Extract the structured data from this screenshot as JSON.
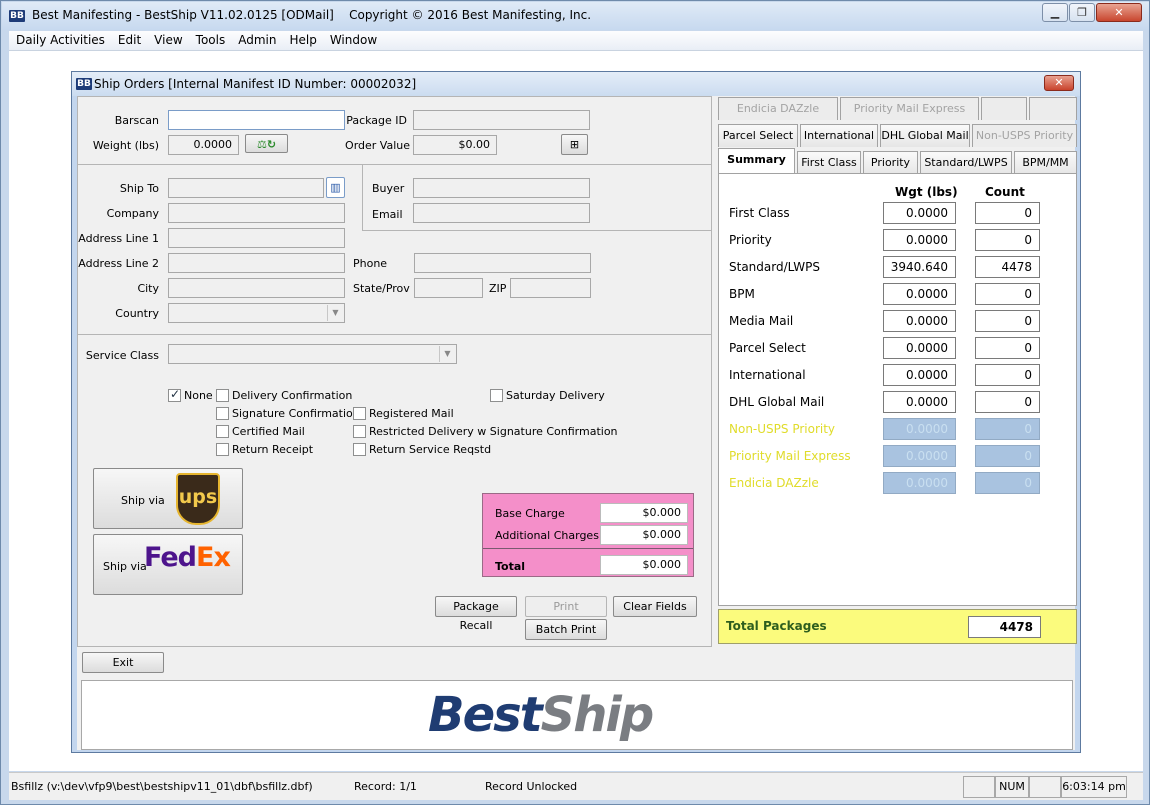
{
  "app": {
    "title": "Best Manifesting - BestShip V11.02.0125 [ODMail]",
    "copyright": "Copyright © 2016 Best Manifesting, Inc.",
    "logo": "BB"
  },
  "menu": [
    "Daily Activities",
    "Edit",
    "View",
    "Tools",
    "Admin",
    "Help",
    "Window"
  ],
  "child": {
    "title": "Ship Orders [Internal Manifest ID Number: 00002032]"
  },
  "form": {
    "barscan_label": "Barscan",
    "barscan_value": "",
    "weight_label": "Weight (lbs)",
    "weight_value": "0.0000",
    "package_id_label": "Package ID",
    "package_id_value": "",
    "order_value_label": "Order Value",
    "order_value_value": "$0.00",
    "ship_to_label": "Ship To",
    "company_label": "Company",
    "address1_label": "Address Line 1",
    "address2_label": "Address Line 2",
    "city_label": "City",
    "country_label": "Country",
    "buyer_label": "Buyer",
    "email_label": "Email",
    "phone_label": "Phone",
    "state_label": "State/Prov",
    "zip_label": "ZIP",
    "service_class_label": "Service Class"
  },
  "options": {
    "none": "None",
    "delivery_confirmation": "Delivery Confirmation",
    "signature_confirmation": "Signature Confirmation",
    "certified_mail": "Certified Mail",
    "return_receipt": "Return Receipt",
    "registered_mail": "Registered Mail",
    "restricted_delivery": "Restricted Delivery w Signature Confirmation",
    "return_service": "Return Service Reqstd",
    "saturday_delivery": "Saturday Delivery"
  },
  "ship": {
    "ship_via": "Ship via",
    "ups": "ups",
    "fedex_fed": "Fed",
    "fedex_ex": "Ex"
  },
  "charges": {
    "base_label": "Base Charge",
    "base_value": "$0.000",
    "additional_label": "Additional Charges",
    "additional_value": "$0.000",
    "total_label": "Total",
    "total_value": "$0.000"
  },
  "buttons": {
    "package_recall": "Package Recall",
    "print": "Print",
    "clear_fields": "Clear Fields",
    "batch_print": "Batch Print",
    "exit": "Exit"
  },
  "tabs": {
    "row1": [
      "Endicia DAZzle",
      "Priority Mail Express",
      "",
      ""
    ],
    "row2": [
      "Parcel Select",
      "International",
      "DHL Global Mail",
      "Non-USPS Priority"
    ],
    "row3": [
      "Summary",
      "First Class",
      "Priority",
      "Standard/LWPS",
      "BPM/MM"
    ]
  },
  "summary": {
    "header_weight": "Wgt (lbs)",
    "header_count": "Count",
    "rows": [
      {
        "label": "First Class",
        "weight": "0.0000",
        "count": "0"
      },
      {
        "label": "Priority",
        "weight": "0.0000",
        "count": "0"
      },
      {
        "label": "Standard/LWPS",
        "weight": "3940.640",
        "count": "4478"
      },
      {
        "label": "BPM",
        "weight": "0.0000",
        "count": "0"
      },
      {
        "label": "Media Mail",
        "weight": "0.0000",
        "count": "0"
      },
      {
        "label": "Parcel Select",
        "weight": "0.0000",
        "count": "0"
      },
      {
        "label": "International",
        "weight": "0.0000",
        "count": "0"
      },
      {
        "label": "DHL Global Mail",
        "weight": "0.0000",
        "count": "0"
      },
      {
        "label": "Non-USPS Priority",
        "weight": "0.0000",
        "count": "0"
      },
      {
        "label": "Priority Mail Express",
        "weight": "0.0000",
        "count": "0"
      },
      {
        "label": "Endicia DAZzle",
        "weight": "0.0000",
        "count": "0"
      }
    ],
    "total_label": "Total Packages",
    "total_value": "4478"
  },
  "brand": {
    "best": "Best",
    "ship": "Ship"
  },
  "status": {
    "path": "Bsfillz (v:\\dev\\vfp9\\best\\bestshipv11_01\\dbf\\bsfillz.dbf)",
    "record": "Record: 1/1",
    "lock": "Record Unlocked",
    "num": "NUM",
    "time": "6:03:14 pm"
  },
  "colors": {
    "charges_bg": "#f48fc9",
    "total_packages_bg": "#fbfb7d",
    "disabled_field": "#a9c3e0",
    "disabled_label": "#e0dc2a",
    "brand_navy": "#1f3c72",
    "brand_gray": "#7a7d82"
  }
}
